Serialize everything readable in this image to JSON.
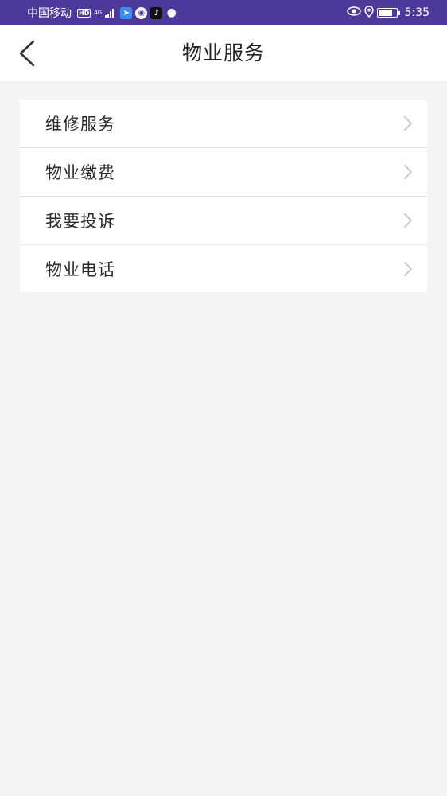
{
  "status_bar": {
    "carrier": "中国移动",
    "hd": "HD",
    "network": "4G",
    "time": "5:35",
    "battery_level": 0.8,
    "colors": {
      "background": "#4b3a9a"
    }
  },
  "header": {
    "title": "物业服务",
    "back_icon": "chevron-left-icon"
  },
  "menu": {
    "items": [
      {
        "label": "维修服务",
        "icon": "chevron-right-icon"
      },
      {
        "label": "物业缴费",
        "icon": "chevron-right-icon"
      },
      {
        "label": "我要投诉",
        "icon": "chevron-right-icon"
      },
      {
        "label": "物业电话",
        "icon": "chevron-right-icon"
      }
    ]
  },
  "colors": {
    "page_background": "#f4f4f4",
    "card_background": "#ffffff",
    "divider": "#e3e3e3",
    "chevron": "#c4c4c4"
  }
}
